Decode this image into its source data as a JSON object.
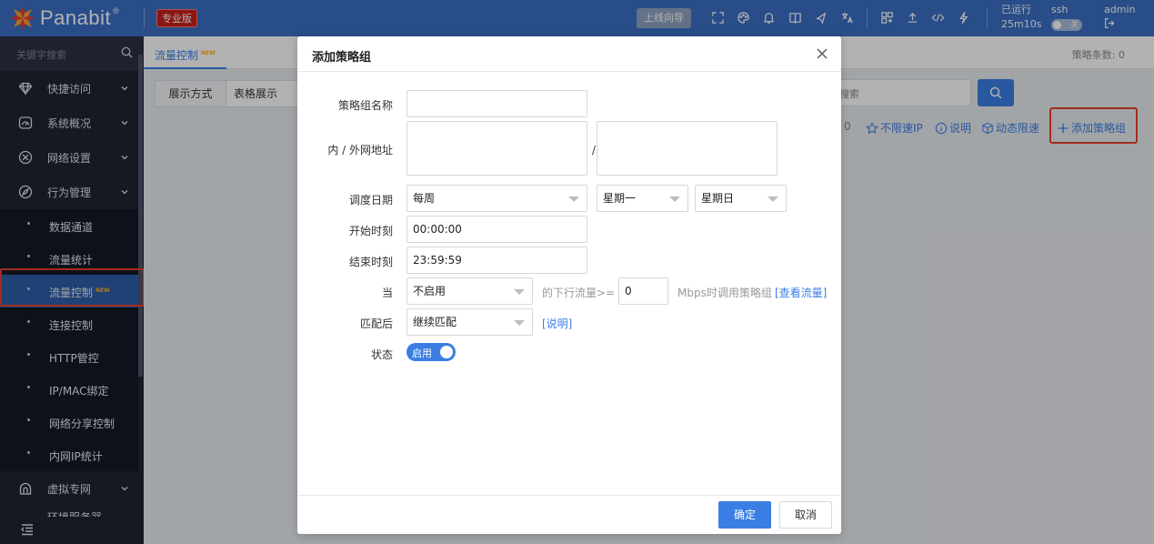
{
  "brand": {
    "name": "Panabit",
    "registered": "®",
    "edition": "专业版"
  },
  "topbar": {
    "guide_label": "上线向导",
    "uptime_label": "已运行",
    "uptime_value": "25m10s",
    "ssh_label": "ssh",
    "ssh_toggle": "关",
    "user": "admin",
    "icons": [
      "fullscreen-icon",
      "palette-icon",
      "bell-icon",
      "book-icon",
      "share-icon",
      "translate-icon",
      "grid-icon",
      "upload-icon",
      "code-icon",
      "bolt-icon",
      "logout-icon"
    ]
  },
  "sidebar": {
    "search_placeholder": "关键字搜索",
    "items": [
      {
        "label": "快捷访问",
        "icon": "diamond-icon"
      },
      {
        "label": "系统概况",
        "icon": "gauge-icon"
      },
      {
        "label": "网络设置",
        "icon": "network-icon"
      },
      {
        "label": "行为管理",
        "icon": "compass-icon"
      }
    ],
    "sub_items": [
      "数据通道",
      "流量统计",
      "流量控制",
      "连接控制",
      "HTTP管控",
      "IP/MAC绑定",
      "网络分享控制",
      "内网IP统计"
    ],
    "active_sub": "流量控制",
    "new_tag": "NEW",
    "bottom_item": {
      "label": "虚拟专网",
      "icon": "vpn-icon"
    },
    "partial_item": "环境服务器"
  },
  "main": {
    "tab_label": "流量控制",
    "policy_count": "策略条数: 0",
    "filter_label": "展示方式",
    "filter_value": "表格展示",
    "search_placeholder": "搜索",
    "count_fragment": "0",
    "actions": {
      "no_limit_ip": "不限速IP",
      "explain": "说明",
      "dynamic_limit": "动态限速",
      "add_group": "添加策略组"
    }
  },
  "modal": {
    "title": "添加策略组",
    "fields": {
      "group_name_label": "策略组名称",
      "group_name_value": "",
      "address_label": "内 / 外网地址",
      "address_sep": "/",
      "schedule_label": "调度日期",
      "schedule_value": "每周",
      "day_from": "星期一",
      "day_to": "星期日",
      "start_label": "开始时刻",
      "start_value": "00:00:00",
      "end_label": "结束时刻",
      "end_value": "23:59:59",
      "when_label": "当",
      "when_value": "不启用",
      "when_hint": "的下行流量>=",
      "threshold_value": "0",
      "threshold_hint": "Mbps时调用策略组",
      "view_traffic_link": "[查看流量]",
      "after_match_label": "匹配后",
      "after_match_value": "继续匹配",
      "explain_link": "[说明]",
      "status_label": "状态",
      "status_value": "启用"
    },
    "confirm_label": "确定",
    "cancel_label": "取消"
  },
  "colors": {
    "topbar": "#3a6fc4",
    "sidebar": "#1d2432",
    "accent": "#3a7ee4",
    "highlight": "#e8402c",
    "edition": "#c8201c"
  }
}
